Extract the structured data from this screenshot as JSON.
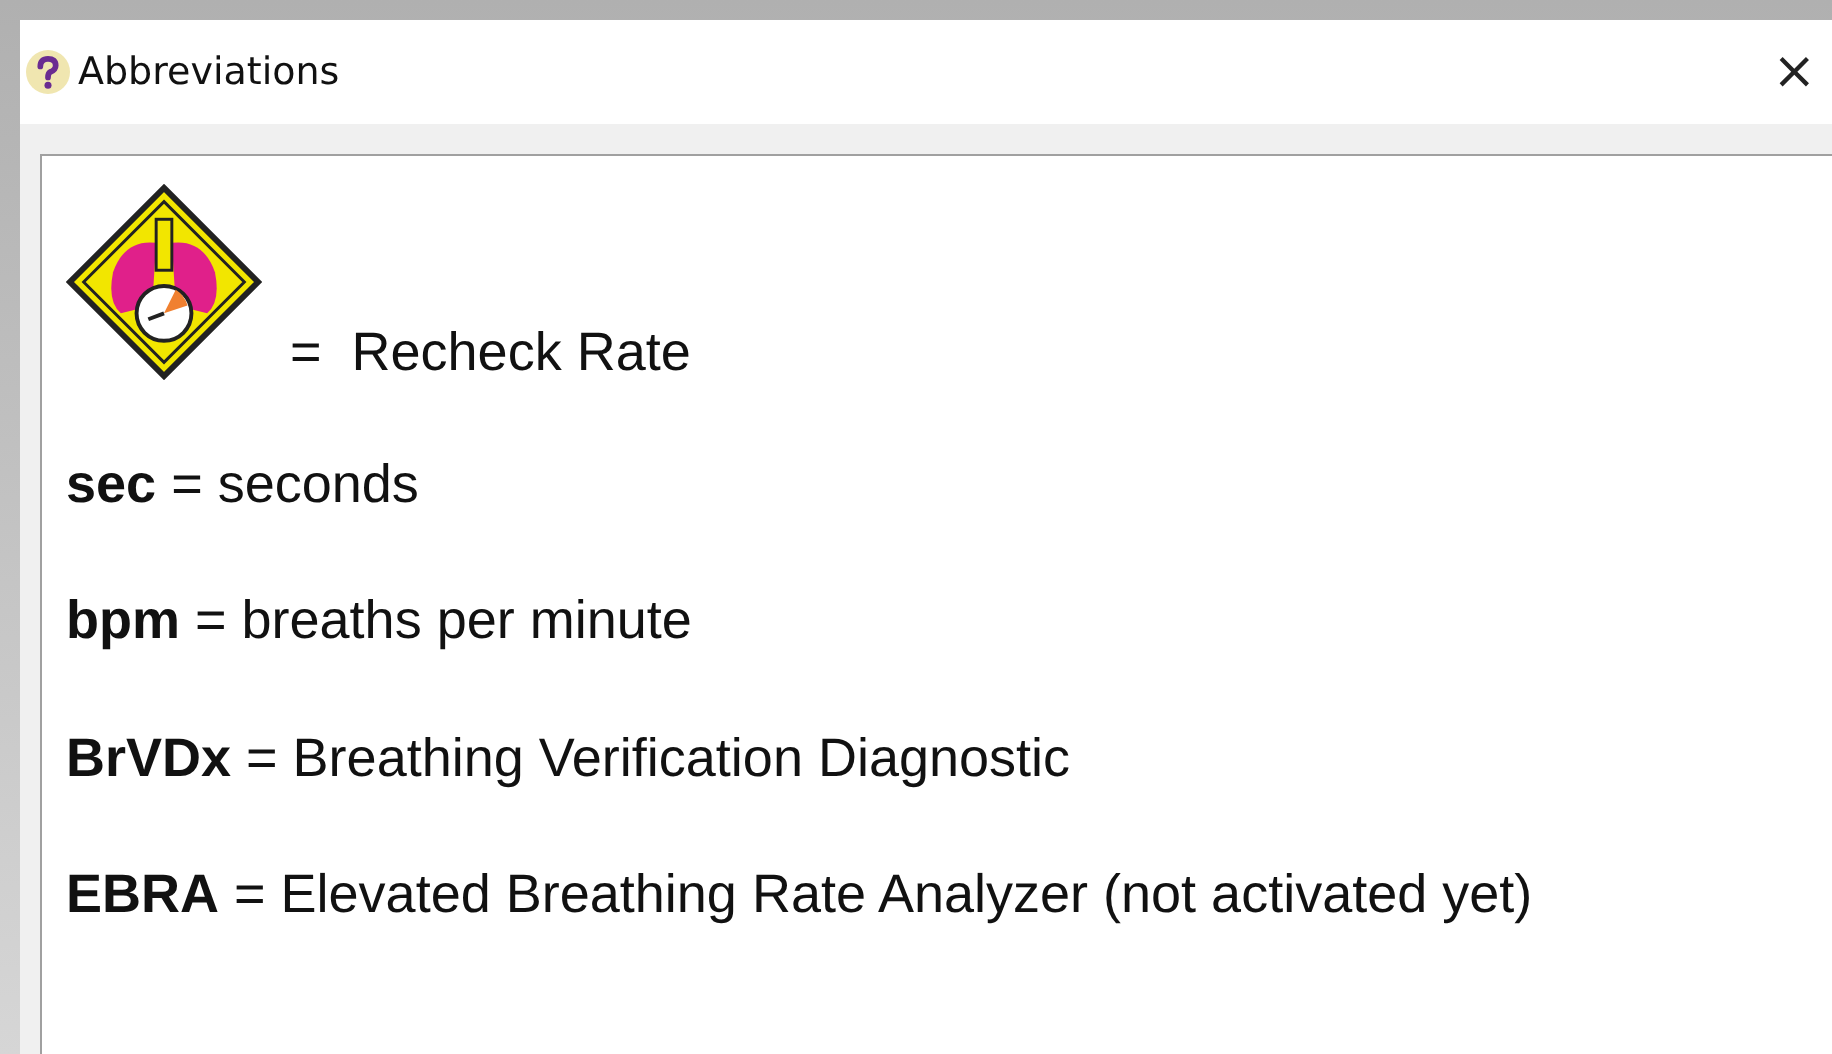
{
  "window": {
    "title": "Abbreviations",
    "close": "×"
  },
  "legend": {
    "text": "=  Recheck Rate"
  },
  "entries": [
    {
      "text": "**sec** = seconds"
    },
    {
      "text": "**bpm** = breaths per minute"
    },
    {
      "text": "**BrVDx** = Breathing Verification Diagnostic"
    },
    {
      "text": "**EBRA** = Elevated Breathing Rate Analyzer (not activated yet)"
    }
  ]
}
